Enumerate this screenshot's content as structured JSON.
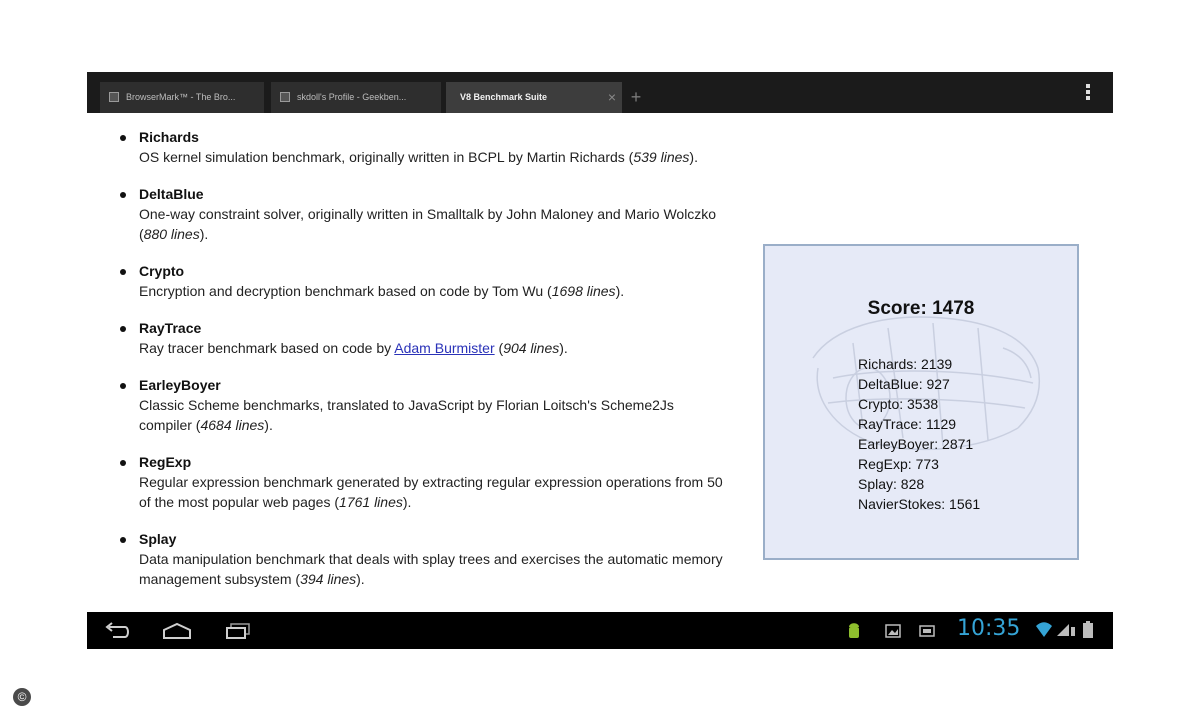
{
  "browser": {
    "tabs": [
      {
        "label": "BrowserMark™ - The Bro..."
      },
      {
        "label": "skdoll's Profile - Geekben..."
      },
      {
        "label": "V8 Benchmark Suite",
        "close": "×"
      }
    ],
    "new_tab": "+"
  },
  "benchmarks": [
    {
      "name": "Richards",
      "desc": "OS kernel simulation benchmark, originally written in BCPL by Martin Richards",
      "lines": "539 lines"
    },
    {
      "name": "DeltaBlue",
      "desc": "One-way constraint solver, originally written in Smalltalk by John Maloney and Mario Wolczko",
      "lines": "880 lines"
    },
    {
      "name": "Crypto",
      "desc": "Encryption and decryption benchmark based on code by Tom Wu",
      "lines": "1698 lines"
    },
    {
      "name": "RayTrace",
      "desc_pre": "Ray tracer benchmark based on code by",
      "link": "Adam Burmister",
      "lines": "904 lines"
    },
    {
      "name": "EarleyBoyer",
      "desc": "Classic Scheme benchmarks, translated to JavaScript by Florian Loitsch's Scheme2Js compiler",
      "lines": "4684 lines"
    },
    {
      "name": "RegExp",
      "desc": "Regular expression benchmark generated by extracting regular expression operations from 50 of the most popular web pages",
      "lines": "1761 lines"
    },
    {
      "name": "Splay",
      "desc": "Data manipulation benchmark that deals with splay trees and exercises the automatic memory management subsystem",
      "lines": "394 lines"
    }
  ],
  "score": {
    "title": "Score: 1478",
    "results": [
      "Richards: 2139",
      "DeltaBlue: 927",
      "Crypto: 3538",
      "RayTrace: 1129",
      "EarleyBoyer: 2871",
      "RegExp: 773",
      "Splay: 828",
      "NavierStokes: 1561"
    ]
  },
  "statusbar": {
    "time": "10:35"
  },
  "icons": {
    "back": "back-icon",
    "home": "home-icon",
    "recent": "recent-apps-icon",
    "menu": "overflow-menu-icon",
    "android": "android-debug-icon",
    "gallery": "gallery-icon",
    "screenshot": "screenshot-icon",
    "wifi": "wifi-icon",
    "battery": "battery-icon"
  },
  "colors": {
    "clock": "#35a4d6",
    "link": "#2a32b8",
    "score_panel": "#e6eaf7"
  },
  "copyright_mark": "©"
}
